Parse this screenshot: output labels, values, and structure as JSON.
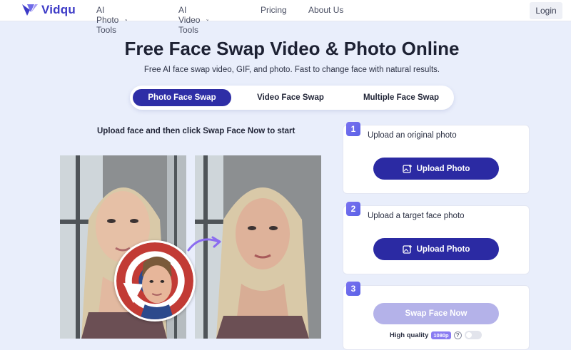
{
  "header": {
    "brand": "Vidqu",
    "nav": [
      {
        "label": "AI Photo Tools",
        "has_dropdown": true
      },
      {
        "label": "AI Video Tools",
        "has_dropdown": true
      },
      {
        "label": "Pricing",
        "has_dropdown": false
      },
      {
        "label": "About Us",
        "has_dropdown": false
      }
    ],
    "login_label": "Login"
  },
  "hero": {
    "title": "Free Face Swap Video & Photo Online",
    "subtitle": "Free AI face swap video, GIF, and photo. Fast to change face with natural results."
  },
  "tabs": [
    {
      "label": "Photo Face Swap",
      "active": true
    },
    {
      "label": "Video Face Swap",
      "active": false
    },
    {
      "label": "Multiple Face Swap",
      "active": false
    }
  ],
  "demo": {
    "instruction": "Upload face and then click Swap Face Now to start"
  },
  "steps": [
    {
      "number": "1",
      "label": "Upload an original photo",
      "button": "Upload Photo"
    },
    {
      "number": "2",
      "label": "Upload a target face photo",
      "button": "Upload Photo"
    },
    {
      "number": "3",
      "button": "Swap Face Now"
    }
  ],
  "quality": {
    "label": "High quality",
    "badge": "1080p",
    "help": "?",
    "enabled": false
  },
  "colors": {
    "brand": "#3d3bc7",
    "primary_button": "#2b2aa3",
    "disabled_button": "#b4b2e9",
    "page_background": "#e9eefb",
    "accent_arrow": "#8b6cf0"
  }
}
